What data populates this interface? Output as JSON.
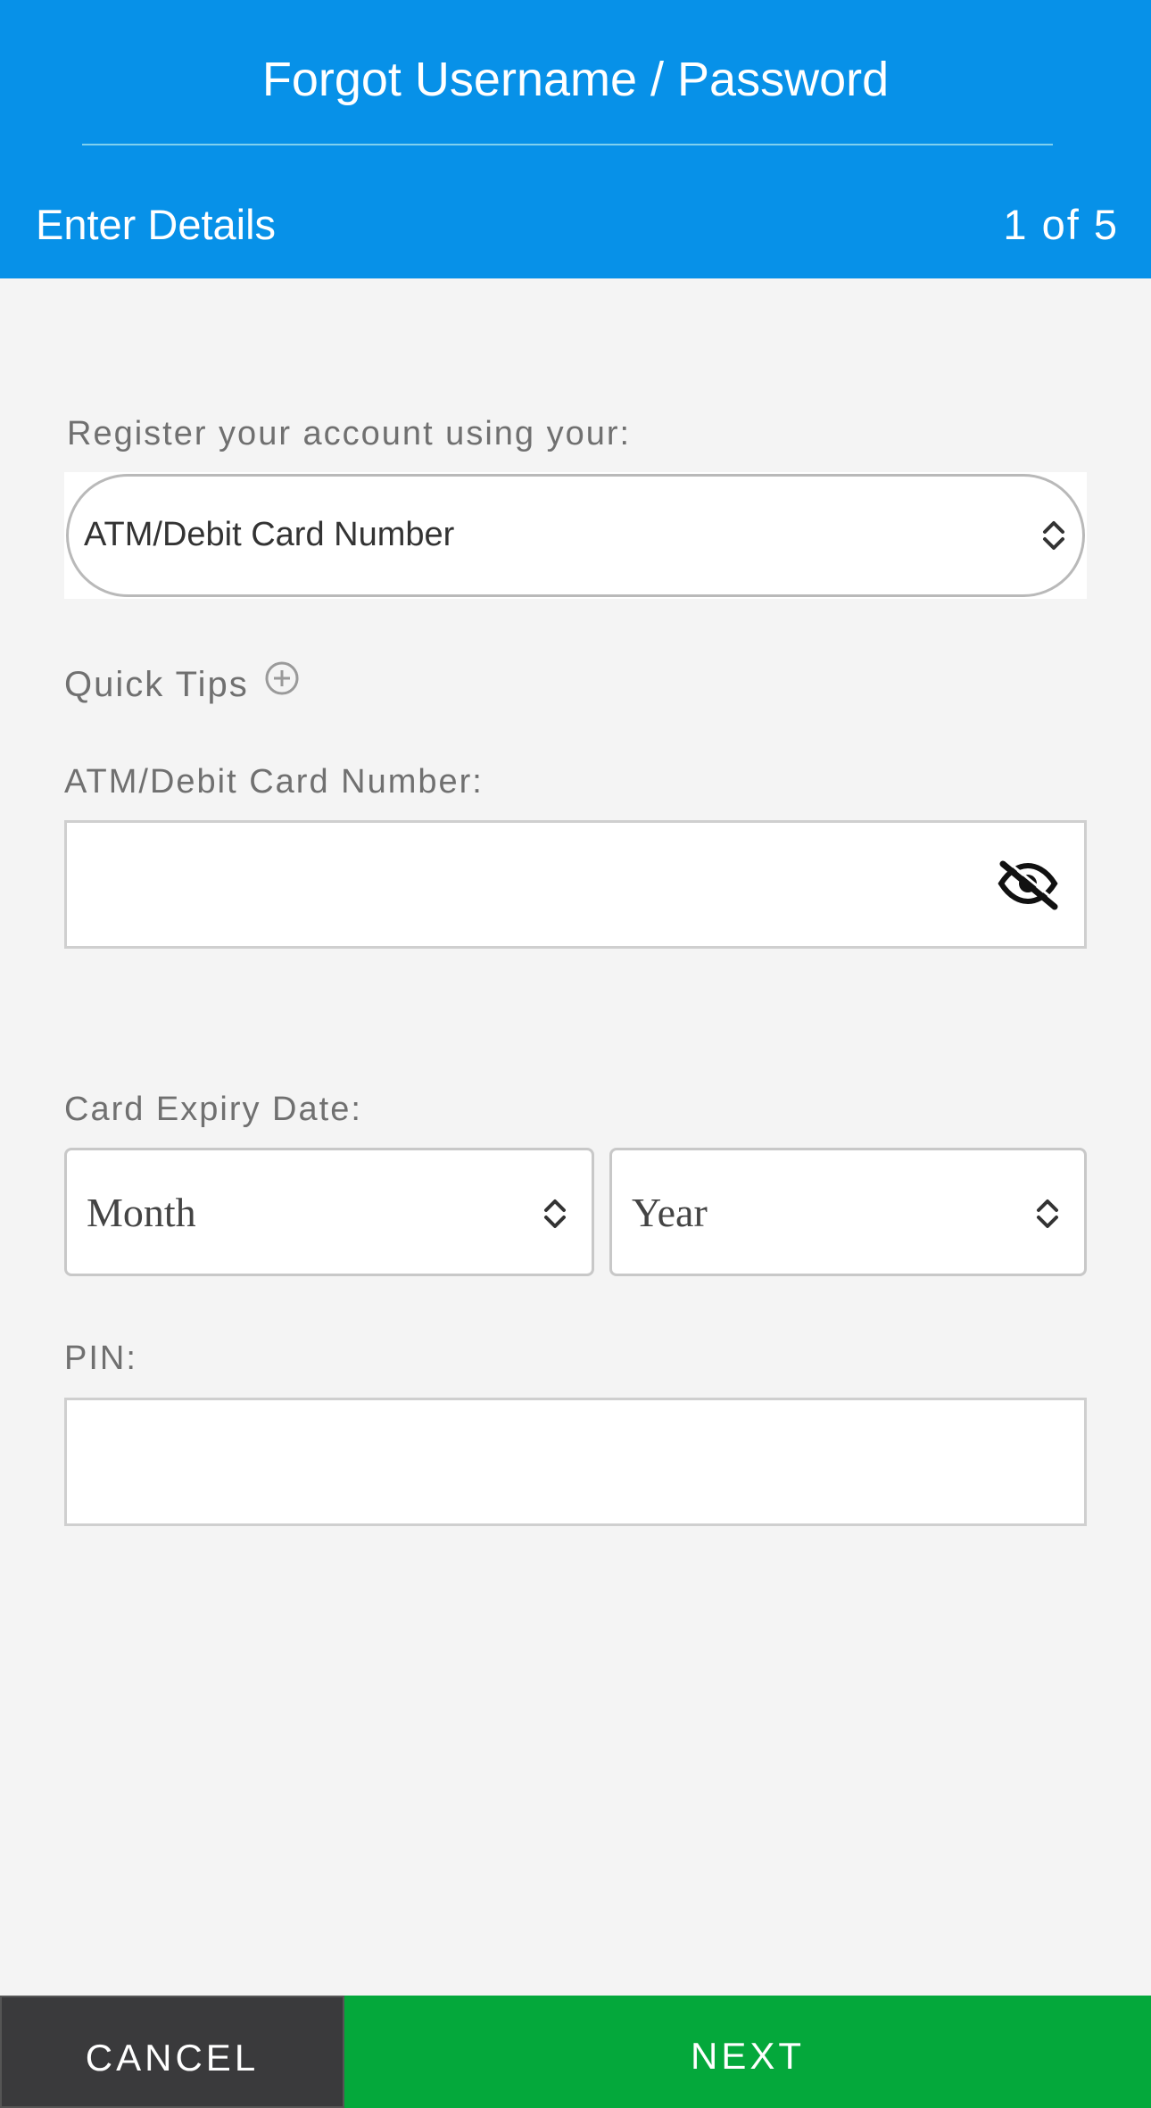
{
  "header": {
    "title": "Forgot Username / Password",
    "step_title": "Enter Details",
    "step_counter": "1 of 5"
  },
  "register": {
    "label": "Register your account using your:",
    "selected_option": "ATM/Debit Card Number"
  },
  "quick_tips": {
    "label": "Quick Tips"
  },
  "card_number": {
    "label": "ATM/Debit Card Number:",
    "value": ""
  },
  "expiry": {
    "label": "Card Expiry Date:",
    "month_value": "Month",
    "year_value": "Year"
  },
  "pin": {
    "label": "PIN:",
    "value": ""
  },
  "footer": {
    "cancel_label": "CANCEL",
    "next_label": "NEXT"
  },
  "colors": {
    "header_bg": "#0791e8",
    "next_bg": "#04a83b",
    "cancel_bg": "#3a3a3c",
    "page_bg": "#f4f4f4"
  },
  "icons": {
    "select_chevron": "chevron-up-down-icon",
    "quick_tips": "plus-circle-icon",
    "visibility": "eye-off-icon"
  }
}
